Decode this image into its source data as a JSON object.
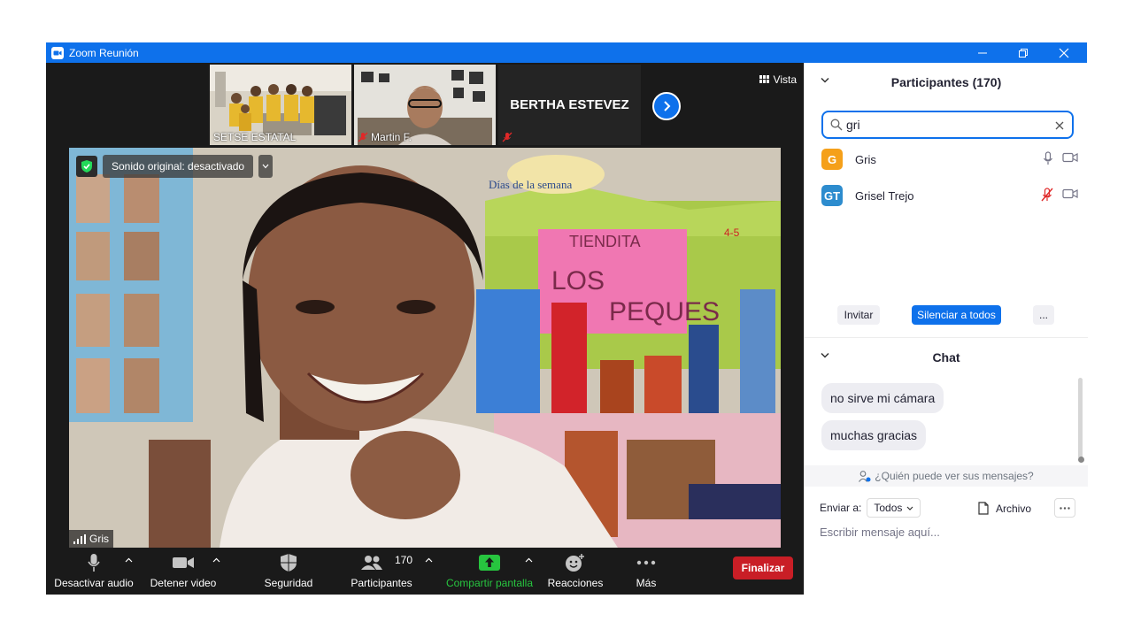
{
  "window": {
    "title": "Zoom Reunión"
  },
  "strip": {
    "tiles": [
      {
        "name": "SETSE ESTATAL"
      },
      {
        "name": "Martin F."
      },
      {
        "name": "BERTHA ESTEVEZ"
      }
    ],
    "view_label": "Vista"
  },
  "main_video": {
    "sound_label": "Sonido original: desactivado",
    "speaker_name": "Gris"
  },
  "toolbar": {
    "audio": "Desactivar audio",
    "video": "Detener video",
    "security": "Seguridad",
    "participants": "Participantes",
    "participants_count": "170",
    "share": "Compartir pantalla",
    "reactions": "Reacciones",
    "more": "Más",
    "end": "Finalizar"
  },
  "participants_panel": {
    "title": "Participantes (170)",
    "search_value": "gri",
    "people": [
      {
        "initials": "G",
        "name": "Gris",
        "color": "#f5a01a"
      },
      {
        "initials": "GT",
        "name": "Grisel Trejo",
        "color": "#2d8cce"
      }
    ],
    "invite": "Invitar",
    "mute_all": "Silenciar a todos",
    "more": "..."
  },
  "chat_panel": {
    "title": "Chat",
    "messages": [
      "no sirve mi cámara",
      "muchas gracias"
    ],
    "who_can_see": "¿Quién puede ver sus mensajes?",
    "send_to_label": "Enviar a:",
    "send_to_value": "Todos",
    "file_label": "Archivo",
    "input_placeholder": "Escribir mensaje aquí..."
  }
}
